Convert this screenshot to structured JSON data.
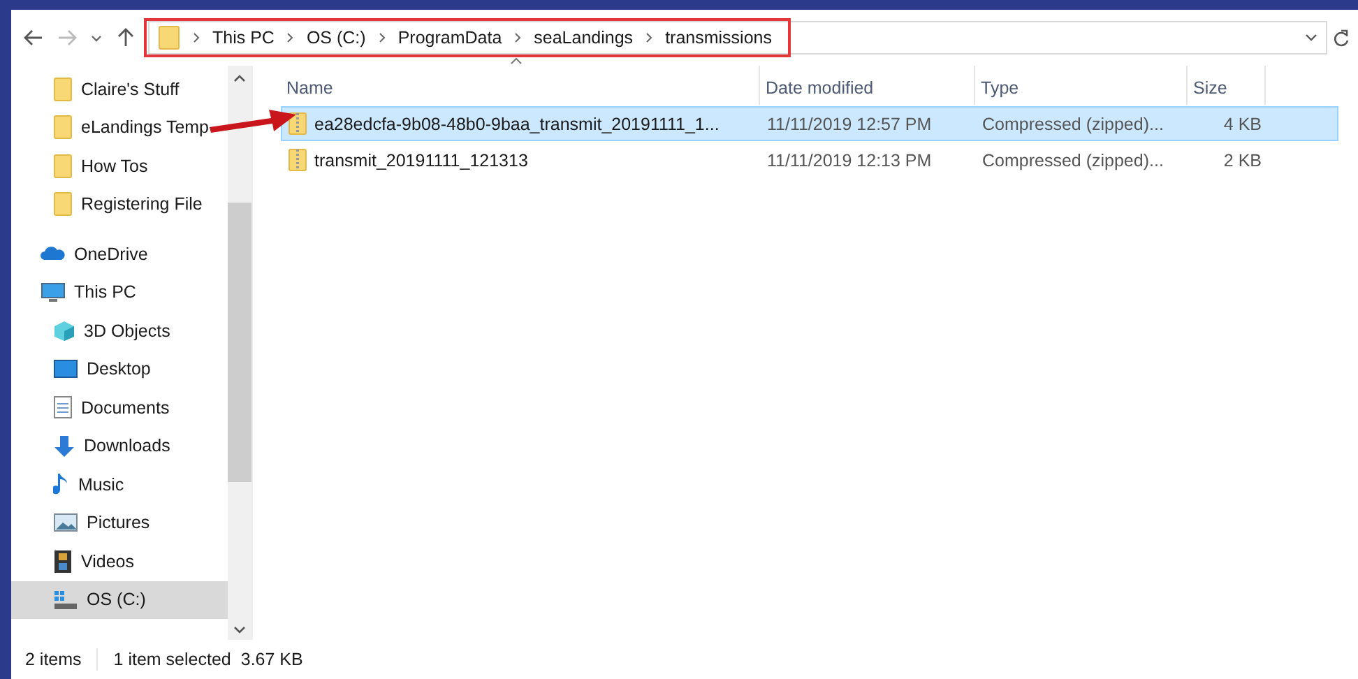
{
  "address_bar": {
    "crumbs": [
      "This PC",
      "OS (C:)",
      "ProgramData",
      "seaLandings",
      "transmissions"
    ]
  },
  "sidebar": {
    "items": [
      {
        "label": "Claire's Stuff",
        "kind": "folder",
        "selected": false
      },
      {
        "label": "eLandings Temp",
        "kind": "folder",
        "selected": false
      },
      {
        "label": "How Tos",
        "kind": "folder",
        "selected": false
      },
      {
        "label": "Registering File",
        "kind": "folder",
        "selected": false
      },
      {
        "label": "OneDrive",
        "kind": "cloud",
        "selected": false
      },
      {
        "label": "This PC",
        "kind": "pc",
        "selected": false,
        "children": [
          {
            "label": "3D Objects",
            "kind": "cube",
            "selected": false
          },
          {
            "label": "Desktop",
            "kind": "desktop",
            "selected": false
          },
          {
            "label": "Documents",
            "kind": "documents",
            "selected": false
          },
          {
            "label": "Downloads",
            "kind": "downloads",
            "selected": false
          },
          {
            "label": "Music",
            "kind": "music",
            "selected": false
          },
          {
            "label": "Pictures",
            "kind": "pictures",
            "selected": false
          },
          {
            "label": "Videos",
            "kind": "videos",
            "selected": false
          },
          {
            "label": "OS (C:)",
            "kind": "drive",
            "selected": true
          }
        ]
      }
    ]
  },
  "table": {
    "columns": [
      "Name",
      "Date modified",
      "Type",
      "Size"
    ],
    "rows": [
      {
        "name": "ea28edcfa-9b08-48b0-9baa_transmit_20191111_1...",
        "date": "11/11/2019 12:57 PM",
        "type": "Compressed (zipped)...",
        "size": "4 KB",
        "selected": true
      },
      {
        "name": "transmit_20191111_121313",
        "date": "11/11/2019 12:13 PM",
        "type": "Compressed (zipped)...",
        "size": "2 KB",
        "selected": false
      }
    ]
  },
  "status_bar": {
    "count": "2 items",
    "selection": "1 item selected",
    "size": "3.67 KB"
  }
}
